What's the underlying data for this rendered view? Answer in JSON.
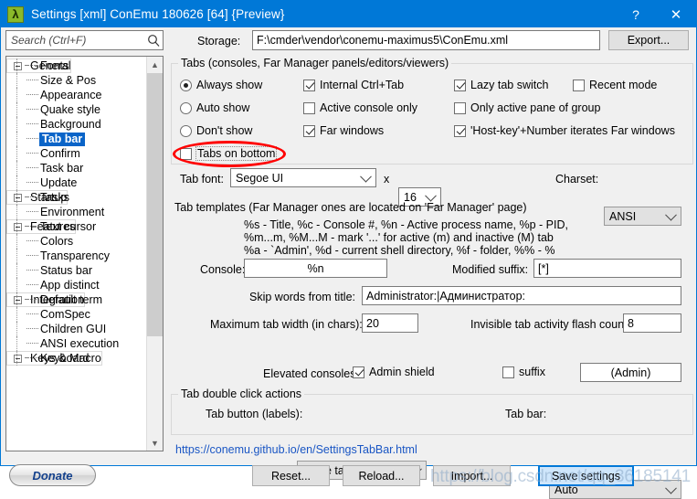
{
  "window": {
    "title": "Settings [xml] ConEmu 180626 [64] {Preview}",
    "icon": "lambda-icon",
    "help_button": "?",
    "close_button": "✕"
  },
  "search": {
    "placeholder": "Search (Ctrl+F)",
    "value": "",
    "icon": "search-icon"
  },
  "storage": {
    "label": "Storage:",
    "value": "F:\\cmder\\vendor\\conemu-maximus5\\ConEmu.xml",
    "export_label": "Export..."
  },
  "tree": {
    "items": [
      {
        "label": "General",
        "level": 0,
        "expanded": true,
        "selected": false
      },
      {
        "label": "Fonts",
        "level": 1,
        "expanded": false,
        "selected": false
      },
      {
        "label": "Size & Pos",
        "level": 1,
        "expanded": false,
        "selected": false
      },
      {
        "label": "Appearance",
        "level": 1,
        "expanded": false,
        "selected": false
      },
      {
        "label": "Quake style",
        "level": 1,
        "expanded": false,
        "selected": false
      },
      {
        "label": "Background",
        "level": 1,
        "expanded": false,
        "selected": false
      },
      {
        "label": "Tab bar",
        "level": 1,
        "expanded": false,
        "selected": true
      },
      {
        "label": "Confirm",
        "level": 1,
        "expanded": false,
        "selected": false
      },
      {
        "label": "Task bar",
        "level": 1,
        "expanded": false,
        "selected": false
      },
      {
        "label": "Update",
        "level": 1,
        "expanded": false,
        "selected": false
      },
      {
        "label": "Startup",
        "level": 0,
        "expanded": true,
        "selected": false
      },
      {
        "label": "Tasks",
        "level": 1,
        "expanded": false,
        "selected": false
      },
      {
        "label": "Environment",
        "level": 1,
        "expanded": false,
        "selected": false
      },
      {
        "label": "Features",
        "level": 0,
        "expanded": true,
        "selected": false
      },
      {
        "label": "Text cursor",
        "level": 1,
        "expanded": false,
        "selected": false
      },
      {
        "label": "Colors",
        "level": 1,
        "expanded": false,
        "selected": false
      },
      {
        "label": "Transparency",
        "level": 1,
        "expanded": false,
        "selected": false
      },
      {
        "label": "Status bar",
        "level": 1,
        "expanded": false,
        "selected": false
      },
      {
        "label": "App distinct",
        "level": 1,
        "expanded": false,
        "selected": false
      },
      {
        "label": "Integration",
        "level": 0,
        "expanded": true,
        "selected": false
      },
      {
        "label": "Default term",
        "level": 1,
        "expanded": false,
        "selected": false
      },
      {
        "label": "ComSpec",
        "level": 1,
        "expanded": false,
        "selected": false
      },
      {
        "label": "Children GUI",
        "level": 1,
        "expanded": false,
        "selected": false
      },
      {
        "label": "ANSI execution",
        "level": 1,
        "expanded": false,
        "selected": false
      },
      {
        "label": "Keys & Macro",
        "level": 0,
        "expanded": true,
        "selected": false
      },
      {
        "label": "Keyboard",
        "level": 1,
        "expanded": false,
        "selected": false
      }
    ]
  },
  "tabs_group": {
    "legend": "Tabs (consoles, Far Manager panels/editors/viewers)",
    "radios": [
      {
        "label": "Always show",
        "checked": true
      },
      {
        "label": "Auto show",
        "checked": false
      },
      {
        "label": "Don't show",
        "checked": false
      }
    ],
    "tabs_on_bottom": {
      "label": "Tabs on bottom",
      "checked": false,
      "annotated": true
    },
    "col2": [
      {
        "label": "Internal Ctrl+Tab",
        "checked": true
      },
      {
        "label": "Active console only",
        "checked": false
      },
      {
        "label": "Far windows",
        "checked": true
      }
    ],
    "col3": [
      {
        "label": "Lazy tab switch",
        "checked": true
      },
      {
        "label": "Only active pane of group",
        "checked": false
      },
      {
        "label": "'Host-key'+Number iterates Far windows",
        "checked": true
      }
    ],
    "col4": [
      {
        "label": "Recent mode",
        "checked": false
      }
    ]
  },
  "tab_font": {
    "label": "Tab font:",
    "family": "Segoe UI",
    "x_label": "x",
    "size": "16",
    "charset_label": "Charset:",
    "charset": "ANSI"
  },
  "templates": {
    "title": "Tab templates (Far Manager ones are located on 'Far Manager' page)",
    "lines": [
      "%s - Title, %c - Console #, %n - Active process name, %p - PID,",
      "%m...m, %M...M - mark '...' for active (m) and inactive (M) tab",
      "%a - `Admin', %d - current shell directory, %f - folder, %% - %"
    ],
    "console_label": "Console:",
    "console_value": "%n",
    "modified_suffix_label": "Modified suffix:",
    "modified_suffix_value": "[*]",
    "skip_words_label": "Skip words from title:",
    "skip_words_value": "Administrator:|Администратор:",
    "max_width_label": "Maximum tab width (in chars):",
    "max_width_value": "20",
    "flash_count_label": "Invisible tab activity flash count:",
    "flash_count_value": "8"
  },
  "elevated": {
    "label": "Elevated consoles:",
    "admin_shield": {
      "label": "Admin shield",
      "checked": true
    },
    "suffix": {
      "label": "suffix",
      "checked": false
    },
    "suffix_value": "(Admin)"
  },
  "double_click": {
    "legend": "Tab double click actions",
    "tab_button_label": "Tab button (labels):",
    "tab_button_value": "Close tab",
    "tab_bar_label": "Tab bar:",
    "tab_bar_value": "Auto"
  },
  "footer": {
    "help_url": "https://conemu.github.io/en/SettingsTabBar.html",
    "donate": "Donate",
    "reset": "Reset...",
    "reload": "Reload...",
    "import": "Import...",
    "save": "Save settings",
    "watermark": "https://blog.csdn.net/qq_36185141"
  },
  "colors": {
    "accent": "#0078d7",
    "selection": "#0a64c8",
    "annotation": "#ff0000",
    "link": "#1a56c4"
  }
}
